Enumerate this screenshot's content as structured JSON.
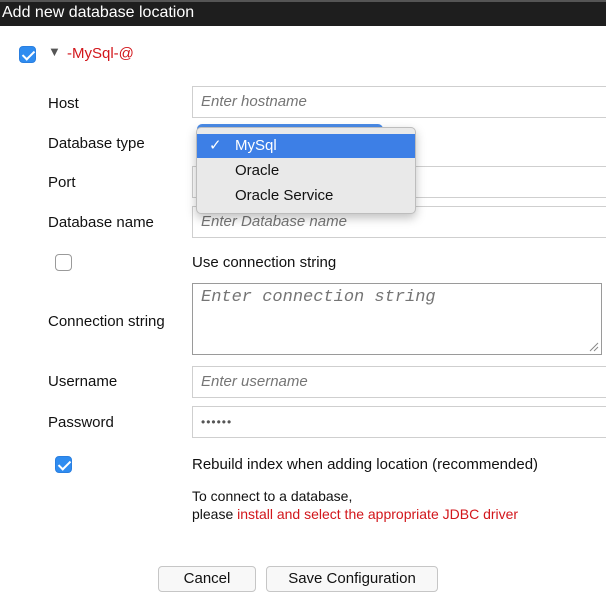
{
  "window": {
    "title": "Add new database location"
  },
  "location": {
    "enabled": true,
    "name": "-MySql-@"
  },
  "form": {
    "host": {
      "label": "Host",
      "placeholder": "Enter hostname"
    },
    "database_type": {
      "label": "Database type",
      "selected": "MySql",
      "options": [
        "MySql",
        "Oracle",
        "Oracle Service"
      ]
    },
    "port": {
      "label": "Port"
    },
    "database_name": {
      "label": "Database name",
      "placeholder": "Enter Database name"
    },
    "use_connection_string": {
      "checked": false,
      "label": "Use connection string"
    },
    "connection_string": {
      "label": "Connection string",
      "placeholder": "Enter connection string"
    },
    "username": {
      "label": "Username",
      "placeholder": "Enter username"
    },
    "password": {
      "label": "Password",
      "value": "••••••"
    },
    "rebuild_index": {
      "checked": true,
      "label": "Rebuild index when adding location (recommended)"
    }
  },
  "help": {
    "line1": "To connect to a database,",
    "line2_prefix": "please ",
    "line2_link": "install and select the appropriate JDBC driver"
  },
  "buttons": {
    "cancel": "Cancel",
    "save": "Save Configuration"
  },
  "colors": {
    "accent": "#2f8cf0",
    "error_red": "#d2161b",
    "titlebar": "#1e1e1e"
  }
}
